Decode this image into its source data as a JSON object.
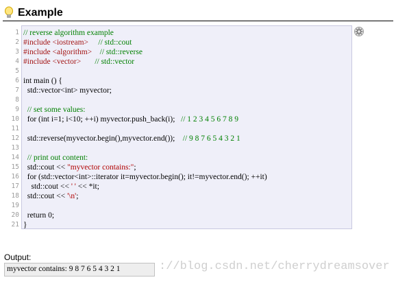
{
  "header": {
    "title": "Example"
  },
  "code": {
    "line_numbers": [
      "1",
      "2",
      "3",
      "4",
      "5",
      "6",
      "7",
      "8",
      "9",
      "10",
      "11",
      "12",
      "13",
      "14",
      "15",
      "16",
      "17",
      "18",
      "19",
      "20",
      "21"
    ],
    "lines": [
      [
        {
          "t": "// reverse algorithm example",
          "c": "cm"
        }
      ],
      [
        {
          "t": "#include <iostream>     ",
          "c": "pp"
        },
        {
          "t": "// std::cout",
          "c": "cm"
        }
      ],
      [
        {
          "t": "#include <algorithm>    ",
          "c": "pp"
        },
        {
          "t": "// std::reverse",
          "c": "cm"
        }
      ],
      [
        {
          "t": "#include <vector>       ",
          "c": "pp"
        },
        {
          "t": "// std::vector",
          "c": "cm"
        }
      ],
      [],
      [
        {
          "t": "int main () {",
          "c": "kw"
        }
      ],
      [
        {
          "t": "  std::vector<int> myvector;",
          "c": "kw"
        }
      ],
      [],
      [
        {
          "t": "  ",
          "c": "kw"
        },
        {
          "t": "// set some values:",
          "c": "cm"
        }
      ],
      [
        {
          "t": "  for (int i=1; i<10; ++i) myvector.push_back(i);   ",
          "c": "kw"
        },
        {
          "t": "// 1 2 3 4 5 6 7 8 9",
          "c": "cm"
        }
      ],
      [],
      [
        {
          "t": "  std::reverse(myvector.begin(),myvector.end());    ",
          "c": "kw"
        },
        {
          "t": "// 9 8 7 6 5 4 3 2 1",
          "c": "cm"
        }
      ],
      [],
      [
        {
          "t": "  ",
          "c": "kw"
        },
        {
          "t": "// print out content:",
          "c": "cm"
        }
      ],
      [
        {
          "t": "  std::cout << ",
          "c": "kw"
        },
        {
          "t": "\"myvector contains:\"",
          "c": "st"
        },
        {
          "t": ";",
          "c": "kw"
        }
      ],
      [
        {
          "t": "  for (std::vector<int>::iterator it=myvector.begin(); it!=myvector.end(); ++it)",
          "c": "kw"
        }
      ],
      [
        {
          "t": "    std::cout << ",
          "c": "kw"
        },
        {
          "t": "' '",
          "c": "st"
        },
        {
          "t": " << *it;",
          "c": "kw"
        }
      ],
      [
        {
          "t": "  std::cout << ",
          "c": "kw"
        },
        {
          "t": "'\\n'",
          "c": "st"
        },
        {
          "t": ";",
          "c": "kw"
        }
      ],
      [],
      [
        {
          "t": "  return 0;",
          "c": "kw"
        }
      ],
      [
        {
          "t": "}",
          "c": "kw"
        }
      ]
    ]
  },
  "output": {
    "label": "Output:",
    "text": "myvector contains: 9 8 7 6 5 4 3 2 1"
  },
  "watermark": "://blog.csdn.net/cherrydreamsover",
  "icons": {
    "bulb": "lightbulb-icon",
    "gear": "gear-icon"
  },
  "colors": {
    "code_bg": "#efeff9",
    "comment": "#008000",
    "preprocessor": "#a31515",
    "string": "#b00000"
  }
}
